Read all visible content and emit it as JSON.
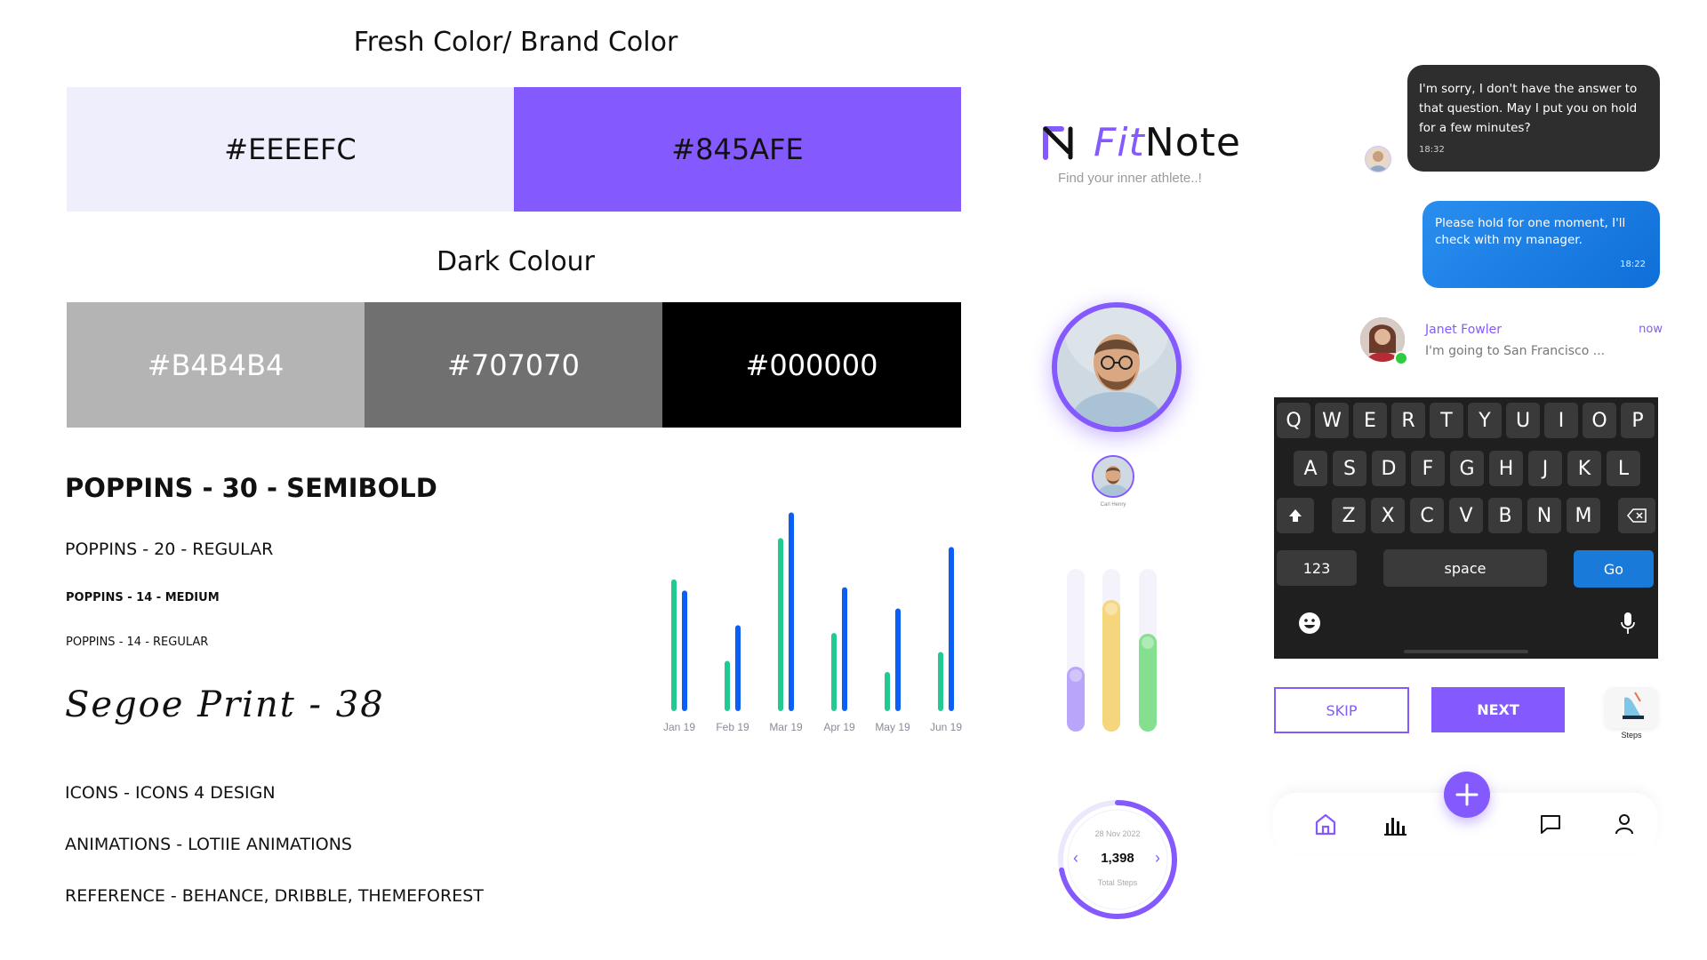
{
  "fresh": {
    "title": "Fresh Color/ Brand Color",
    "swatches": [
      {
        "label": "#EEEEFC",
        "color": "#EEEEFC"
      },
      {
        "label": "#845AFE",
        "color": "#845AFE"
      }
    ]
  },
  "dark": {
    "title": "Dark Colour",
    "swatches": [
      {
        "label": "#B4B4B4",
        "color": "#B4B4B4"
      },
      {
        "label": "#707070",
        "color": "#707070"
      },
      {
        "label": "#000000",
        "color": "#000000"
      }
    ]
  },
  "typography": {
    "line1": "POPPINS - 30 - SEMIBOLD",
    "line2": "POPPINS - 20 - REGULAR",
    "line3": "POPPINS - 14 - MEDIUM",
    "line4": "POPPINS - 14 - REGULAR",
    "line5": "Segoe Print - 38",
    "icons": "ICONS - ICONS 4 DESIGN",
    "animations": "ANIMATIONS - LOTIIE ANIMATIONS",
    "reference": "REFERENCE - BEHANCE, DRIBBLE, THEMEFOREST"
  },
  "chart_data": {
    "type": "bar",
    "categories": [
      "Jan 19",
      "Feb 19",
      "Mar 19",
      "Apr 19",
      "May 19",
      "Jun 19"
    ],
    "series": [
      {
        "values": [
          118,
          45,
          155,
          70,
          35,
          53
        ],
        "color": "#22C993"
      },
      {
        "values": [
          108,
          77,
          178,
          111,
          92,
          147
        ],
        "color": "#0C5FF5"
      }
    ],
    "ylim": [
      0,
      180
    ]
  },
  "brand": {
    "logo_fit": "Fit",
    "logo_note": "Note",
    "tagline": "Find your inner athlete..!",
    "accent": "#845AFE"
  },
  "profile": {
    "small_caption": "Carl Henry"
  },
  "level_bars": [
    {
      "level": 0.4,
      "color": "#B9A6FB"
    },
    {
      "level": 0.81,
      "color": "#F5D67C"
    },
    {
      "level": 0.6,
      "color": "#84E08F"
    }
  ],
  "steps_ring": {
    "date": "28 Nov 2022",
    "value": "1,398",
    "label": "Total Steps",
    "progress": 0.72
  },
  "chat": {
    "incoming": {
      "text": "I'm sorry, I don't have the answer to that question. May I put you on hold for a few minutes?",
      "time": "18:32"
    },
    "outgoing": {
      "text": "Please hold for one moment, I'll check with my manager.",
      "time": "18:22"
    },
    "contact": {
      "name": "Janet Fowler",
      "preview": "I'm going to San Francisco ...",
      "time": "now"
    }
  },
  "keyboard": {
    "row1": [
      "Q",
      "W",
      "E",
      "R",
      "T",
      "Y",
      "U",
      "I",
      "O",
      "P"
    ],
    "row2": [
      "A",
      "S",
      "D",
      "F",
      "G",
      "H",
      "J",
      "K",
      "L"
    ],
    "row3": [
      "Z",
      "X",
      "C",
      "V",
      "B",
      "N",
      "M"
    ],
    "numbers": "123",
    "space": "space",
    "go": "Go"
  },
  "onboarding": {
    "skip": "SKIP",
    "next": "NEXT",
    "steps_label": "Steps"
  }
}
